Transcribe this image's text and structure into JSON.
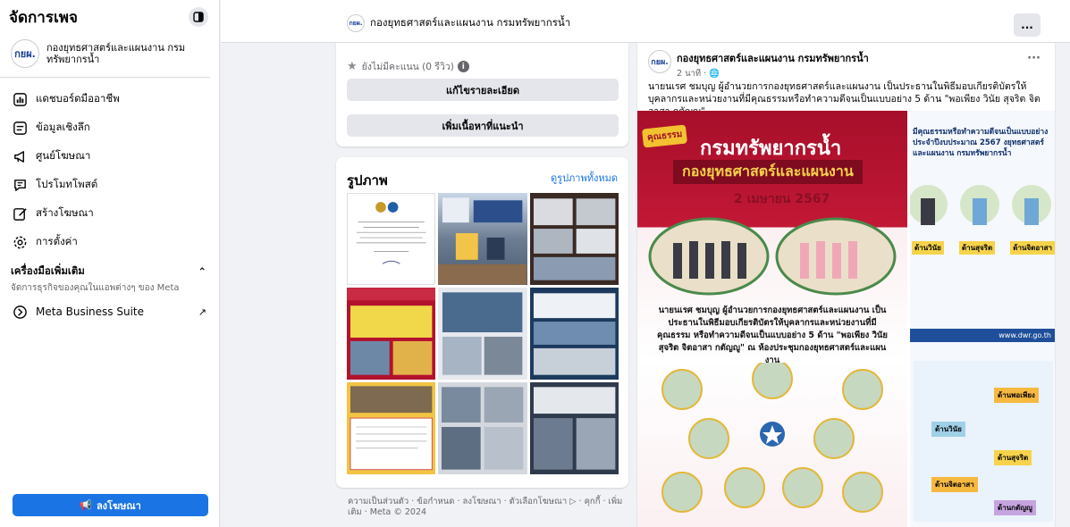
{
  "sidebar": {
    "title": "จัดการเพจ",
    "page_name": "กองยุทธศาสตร์และแผนงาน กรมทรัพยากรน้ำ",
    "page_logo_text": "กยผ.",
    "items": [
      {
        "label": "แดชบอร์ดมืออาชีพ",
        "icon": "dashboard-icon"
      },
      {
        "label": "ข้อมูลเชิงลึก",
        "icon": "insights-icon"
      },
      {
        "label": "ศูนย์โฆษณา",
        "icon": "megaphone-icon"
      },
      {
        "label": "โปรโมทโพสต์",
        "icon": "promote-icon"
      },
      {
        "label": "สร้างโฆษณา",
        "icon": "pencil-icon"
      },
      {
        "label": "การตั้งค่า",
        "icon": "gear-icon"
      }
    ],
    "tools_title": "เครื่องมือเพิ่มเติม",
    "tools_subtitle": "จัดการธุรกิจของคุณในแอพต่างๆ ของ Meta",
    "meta_suite": "Meta Business Suite",
    "ad_button": "ลงโฆษณา"
  },
  "topbar": {
    "page_name": "กองยุทธศาสตร์และแผนงาน กรมทรัพยากรน้ำ",
    "more": "..."
  },
  "middle": {
    "rating_text": "ยังไม่มีคะแนน (0 รีวิว)",
    "edit_details": "แก้ไขรายละเอียด",
    "add_recommended": "เพิ่มเนื้อหาที่แนะนำ",
    "photos_title": "รูปภาพ",
    "photos_link": "ดูรูปภาพทั้งหมด",
    "footer": "ความเป็นส่วนตัว · ข้อกำหนด · ลงโฆษณา · ตัวเลือกโฆษณา ▷ · คุกกี้ · เพิ่มเติม · Meta © 2024"
  },
  "post": {
    "author": "กองยุทธศาสตร์และแผนงาน กรมทรัพยากรน้ำ",
    "time": "2 นาที · 🌐",
    "text": "นายนเรศ ชมบุญ ผู้อำนวยการกองยุทธศาสตร์และแผนงาน เป็นประธานในพิธีมอบเกียรติบัตรให้บุคลากรและหน่วยงานที่มีคุณธรรมหรือทำความดีจนเป็นแบบอย่าง 5 ด้าน \"พอเพียง วินัย สุจริต จิตอาสา กตัญญู\"",
    "img_title": "กรมทรัพยากรน้ำ",
    "img_subtitle": "กองยุทธศาสตร์และแผนงาน",
    "img_date": "2 เมษายน 2567",
    "img_badge": "คุณธรรม",
    "img_caption": "นายนเรศ ชมบุญ ผู้อำนวยการกองยุทธศาสตร์และแผนงาน เป็นประธานในพิธีมอบเกียรติบัตรให้บุคลากรและหน่วยงานที่มีคุณธรรม หรือทำความดีจนเป็นแบบอย่าง 5 ด้าน \"พอเพียง วินัย สุจริต จิตอาสา กตัญญู\" ณ ห้องประชุมกองยุทธศาสตร์และแผนงาน",
    "img2_header": "มีคุณธรรมหรือทำความดีจนเป็นแบบอย่าง ประจำปีงบประมาณ 2567 งยุทธศาสตร์และแผนงาน กรมทรัพยากรน้ำ",
    "img2_labels": [
      "ด้านวินัย",
      "ด้านสุจริต",
      "ด้านจิตอาสา"
    ],
    "img2_url": "www.dwr.go.th",
    "img2_side": [
      "ด้านพอเพียง",
      "ด้านวินัย",
      "ด้านสุจริต",
      "ด้านจิตอาสา",
      "ด้านกตัญญู"
    ]
  }
}
